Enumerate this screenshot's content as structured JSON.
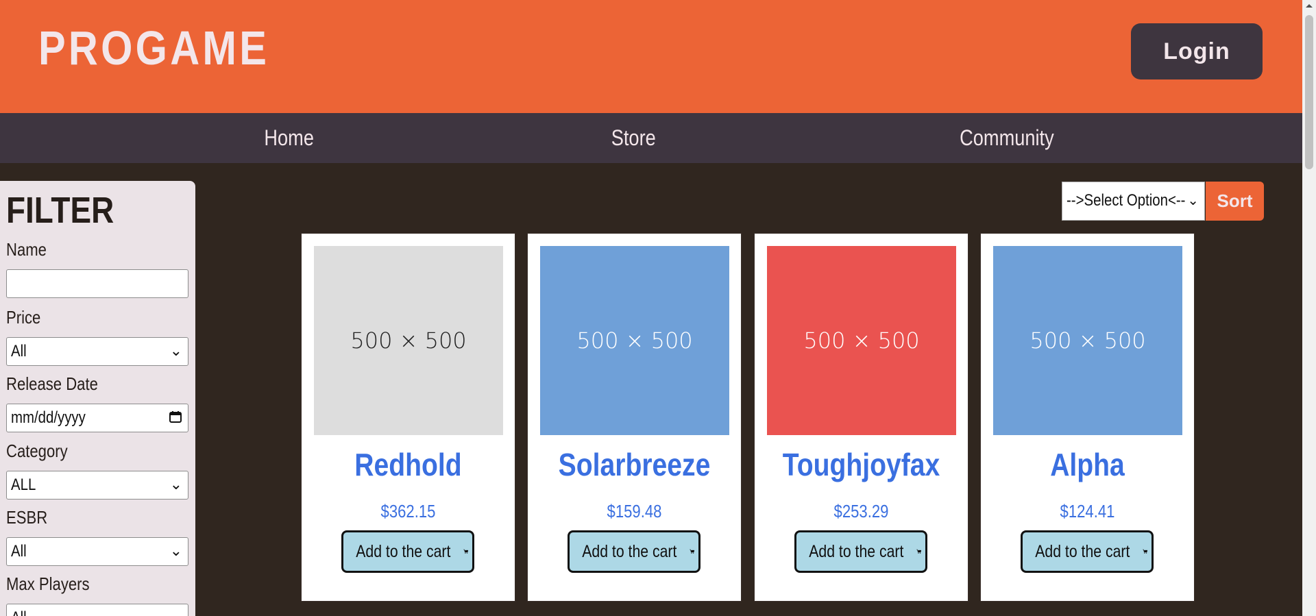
{
  "header": {
    "brand": "PROGAME",
    "login_label": "Login"
  },
  "nav": {
    "items": [
      "Home",
      "Store",
      "Community"
    ]
  },
  "filter": {
    "title": "FILTER",
    "name_label": "Name",
    "name_value": "",
    "price_label": "Price",
    "price_value": "All",
    "release_label": "Release Date",
    "release_value": "mm/dd/yyyy",
    "category_label": "Category",
    "category_value": "ALL",
    "esbr_label": "ESBR",
    "esbr_value": "All",
    "players_label": "Max Players",
    "players_value": "All"
  },
  "sort": {
    "select_value": "-->Select Option<--",
    "button_label": "Sort"
  },
  "products": [
    {
      "title": "Redhold",
      "price": "$362.15",
      "image_text": "500 × 500",
      "image_bg": "#dddddd",
      "image_fg": "#222222",
      "cart_label": "Add to the cart"
    },
    {
      "title": "Solarbreeze",
      "price": "$159.48",
      "image_text": "500 × 500",
      "image_bg": "#6fa0d8",
      "image_fg": "#ffffff",
      "cart_label": "Add to the cart"
    },
    {
      "title": "Toughjoyfax",
      "price": "$253.29",
      "image_text": "500 × 500",
      "image_bg": "#ea5350",
      "image_fg": "#ffffff",
      "cart_label": "Add to the cart"
    },
    {
      "title": "Alpha",
      "price": "$124.41",
      "image_text": "500 × 500",
      "image_bg": "#6fa0d8",
      "image_fg": "#ffffff",
      "cart_label": "Add to the cart"
    }
  ],
  "colors": {
    "header_bg": "#ec6436",
    "nav_bg": "#3e3540",
    "page_bg": "#30261f",
    "accent_text": "#3a6fe0",
    "cart_button_bg": "#add8e6"
  },
  "icons": {
    "cart": "cart-icon",
    "chevron": "chevron-down-icon",
    "calendar": "calendar-icon"
  }
}
